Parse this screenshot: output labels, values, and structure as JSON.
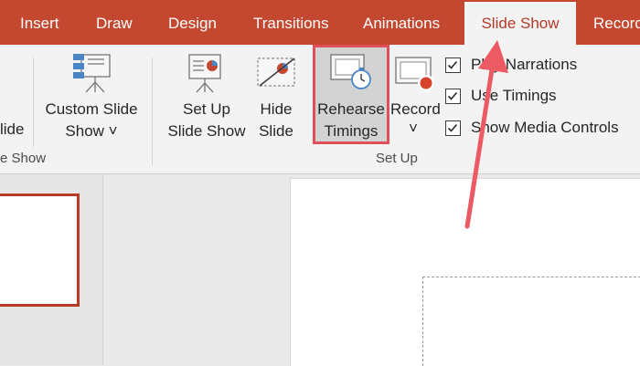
{
  "tabs": [
    {
      "label": "Insert"
    },
    {
      "label": "Draw"
    },
    {
      "label": "Design"
    },
    {
      "label": "Transitions"
    },
    {
      "label": "Animations"
    },
    {
      "label": "Slide Show",
      "active": true
    },
    {
      "label": "Record"
    }
  ],
  "ribbon": {
    "start_group": {
      "fragment_label": "lide",
      "group_label": "e Show"
    },
    "custom_slide_show": {
      "line1": "Custom Slide",
      "line2": "Show ˅"
    },
    "set_up_slide_show": {
      "line1": "Set Up",
      "line2": "Slide Show"
    },
    "hide_slide": {
      "line1": "Hide",
      "line2": "Slide"
    },
    "rehearse_timings": {
      "line1": "Rehearse",
      "line2": "Timings"
    },
    "record": {
      "line1": "Record",
      "chevron": "˅"
    },
    "checkboxes": [
      {
        "label": "Play Narrations",
        "checked": true
      },
      {
        "label": "Use Timings",
        "checked": true
      },
      {
        "label": "Show Media Controls",
        "checked": true
      }
    ],
    "set_up_group_label": "Set Up"
  },
  "colors": {
    "tab_bar": "#c4472f",
    "accent_highlight": "#e0505a",
    "ribbon_bg": "#f3f3f3"
  }
}
